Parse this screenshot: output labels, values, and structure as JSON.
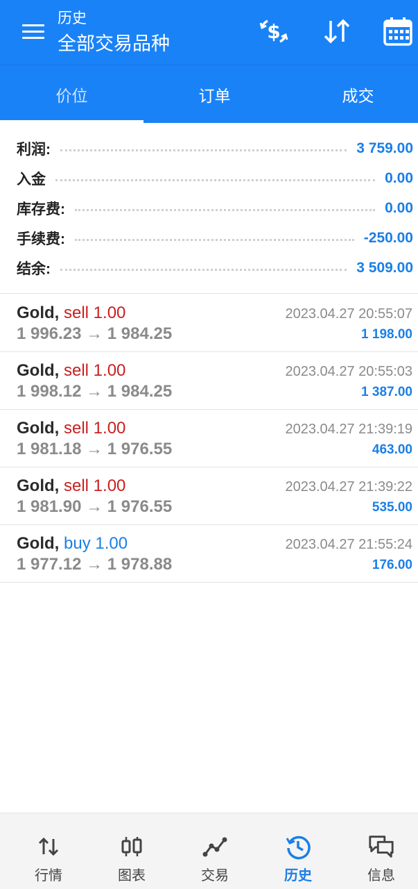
{
  "header": {
    "subtitle": "历史",
    "title": "全部交易品种"
  },
  "tabs": [
    {
      "label": "价位",
      "active": true
    },
    {
      "label": "订单",
      "active": false
    },
    {
      "label": "成交",
      "active": false
    }
  ],
  "summary": [
    {
      "label": "利润:",
      "value": "3 759.00"
    },
    {
      "label": "入金",
      "value": "0.00"
    },
    {
      "label": "库存费:",
      "value": "0.00"
    },
    {
      "label": "手续费:",
      "value": "-250.00"
    },
    {
      "label": "结余:",
      "value": "3 509.00"
    }
  ],
  "deals": [
    {
      "symbol": "Gold,",
      "side": "sell 1.00",
      "type": "sell",
      "prices": "1 996.23 → 1 984.25",
      "time": "2023.04.27 20:55:07",
      "profit": "1 198.00"
    },
    {
      "symbol": "Gold,",
      "side": "sell 1.00",
      "type": "sell",
      "prices": "1 998.12 → 1 984.25",
      "time": "2023.04.27 20:55:03",
      "profit": "1 387.00"
    },
    {
      "symbol": "Gold,",
      "side": "sell 1.00",
      "type": "sell",
      "prices": "1 981.18 → 1 976.55",
      "time": "2023.04.27 21:39:19",
      "profit": "463.00"
    },
    {
      "symbol": "Gold,",
      "side": "sell 1.00",
      "type": "sell",
      "prices": "1 981.90 → 1 976.55",
      "time": "2023.04.27 21:39:22",
      "profit": "535.00"
    },
    {
      "symbol": "Gold,",
      "side": "buy 1.00",
      "type": "buy",
      "prices": "1 977.12 → 1 978.88",
      "time": "2023.04.27 21:55:24",
      "profit": "176.00"
    }
  ],
  "nav": [
    {
      "label": "行情",
      "icon": "quotes-arrows-icon"
    },
    {
      "label": "图表",
      "icon": "candlestick-chart-icon"
    },
    {
      "label": "交易",
      "icon": "trade-line-icon"
    },
    {
      "label": "历史",
      "icon": "history-clock-icon",
      "active": true
    },
    {
      "label": "信息",
      "icon": "messages-icon"
    }
  ],
  "colors": {
    "brand": "#1a82f7",
    "sell": "#c91f1f",
    "buy": "#1a7fe6",
    "value": "#1a7fe6"
  }
}
